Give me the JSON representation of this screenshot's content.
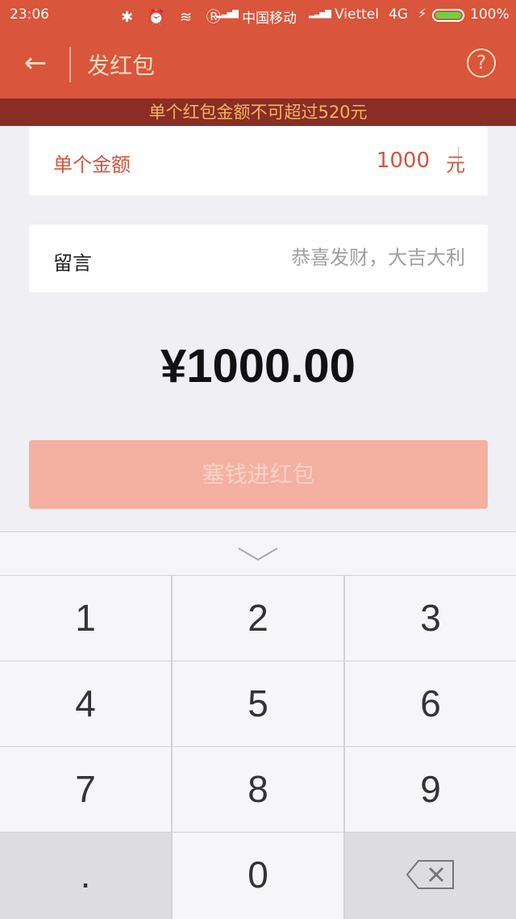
{
  "status_bar": {
    "time": "23:06",
    "system_icons": "✱ ⏰ ≋ Ⓡ",
    "signal_bars": "▂▃▅▇",
    "carrier1": "中国移动",
    "carrier2": "Viettel",
    "network": "4G",
    "battery_percent": "100%",
    "battery_level": 1.0,
    "battery_color": "#6fd13f"
  },
  "nav": {
    "back_icon": "←",
    "title": "发红包",
    "help_icon": "?"
  },
  "warning": "单个红包金额不可超过520元",
  "amount_card": {
    "label": "单个金额",
    "value": "1000",
    "unit": "元"
  },
  "message_card": {
    "label": "留言",
    "placeholder": "恭喜发财，大吉大利"
  },
  "total": "¥1000.00",
  "submit_label": "塞钱进红包",
  "keyboard": {
    "keys": [
      "1",
      "2",
      "3",
      "4",
      "5",
      "6",
      "7",
      "8",
      "9",
      ".",
      "0"
    ]
  },
  "colors": {
    "header": "#d9553b",
    "warning_bg": "#8a2d24",
    "warning_text": "#f5b560",
    "accent": "#d6553c",
    "submit_disabled": "#f4b0a0"
  }
}
